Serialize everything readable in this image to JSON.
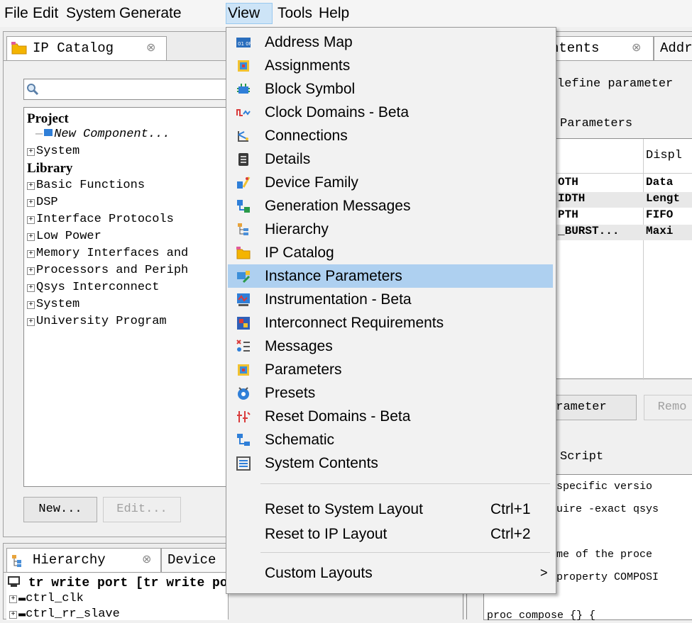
{
  "menubar": {
    "items": [
      "File",
      "Edit",
      "System",
      "Generate",
      "View",
      "Tools",
      "Help"
    ]
  },
  "ip_catalog": {
    "tab_label": "IP Catalog",
    "close_glyph": "⊗",
    "search_placeholder": "",
    "tree": {
      "project_header": "Project",
      "new_component": "New Component...",
      "system": "System",
      "library_header": "Library",
      "library_items": [
        "Basic Functions",
        "DSP",
        "Interface Protocols",
        "Low Power",
        "Memory Interfaces and",
        "Processors and Periph",
        "Qsys Interconnect",
        "System",
        "University Program"
      ]
    },
    "buttons": {
      "new": "New...",
      "edit": "Edit..."
    }
  },
  "hierarchy": {
    "tab_label": "Hierarchy",
    "device_tab": "Device",
    "root": "tr write port [tr write port.qsys]",
    "children": [
      "ctrl_clk",
      "ctrl_rr_slave"
    ]
  },
  "right_panel": {
    "tabs": [
      "ntents",
      "Addr"
    ],
    "define_text": "lefine parameter",
    "section_parameters": "Parameters",
    "column_header": "Displ",
    "rows": [
      {
        "name": "OTH",
        "display": "Data"
      },
      {
        "name": "IDTH",
        "display": "Lengt"
      },
      {
        "name": "PTH",
        "display": "FIFO"
      },
      {
        "name": "_BURST...",
        "display": "Maxi"
      }
    ],
    "add_button": "rameter",
    "remove_button": "Remo",
    "script_title": "Script",
    "script_lines": [
      " a specific versio",
      "equire -exact qsys",
      "",
      " name of the proce",
      "e_property COMPOSI",
      "",
      "proc compose {} {"
    ]
  },
  "view_menu": {
    "items": [
      {
        "label": "Address Map",
        "icon": "address-map-icon"
      },
      {
        "label": "Assignments",
        "icon": "assignments-icon"
      },
      {
        "label": "Block Symbol",
        "icon": "block-symbol-icon"
      },
      {
        "label": "Clock Domains - Beta",
        "icon": "clock-domains-icon"
      },
      {
        "label": "Connections",
        "icon": "connections-icon"
      },
      {
        "label": "Details",
        "icon": "details-icon"
      },
      {
        "label": "Device Family",
        "icon": "device-family-icon"
      },
      {
        "label": "Generation Messages",
        "icon": "generation-messages-icon"
      },
      {
        "label": "Hierarchy",
        "icon": "hierarchy-icon"
      },
      {
        "label": "IP Catalog",
        "icon": "ip-catalog-icon"
      },
      {
        "label": "Instance Parameters",
        "icon": "instance-parameters-icon"
      },
      {
        "label": "Instrumentation - Beta",
        "icon": "instrumentation-icon"
      },
      {
        "label": "Interconnect Requirements",
        "icon": "interconnect-requirements-icon"
      },
      {
        "label": "Messages",
        "icon": "messages-icon"
      },
      {
        "label": "Parameters",
        "icon": "parameters-icon"
      },
      {
        "label": "Presets",
        "icon": "presets-icon"
      },
      {
        "label": "Reset Domains - Beta",
        "icon": "reset-domains-icon"
      },
      {
        "label": "Schematic",
        "icon": "schematic-icon"
      },
      {
        "label": "System Contents",
        "icon": "system-contents-icon"
      }
    ],
    "layout_items": [
      {
        "label": "Reset to System Layout",
        "shortcut": "Ctrl+1"
      },
      {
        "label": "Reset to IP Layout",
        "shortcut": "Ctrl+2"
      }
    ],
    "custom_layouts": {
      "label": "Custom Layouts",
      "arrow": ">"
    },
    "highlighted": "Instance Parameters"
  },
  "colors": {
    "menu_highlight": "#aed0f0",
    "menubar_active": "#cde4f7",
    "folder_yellow": "#f4b400"
  }
}
